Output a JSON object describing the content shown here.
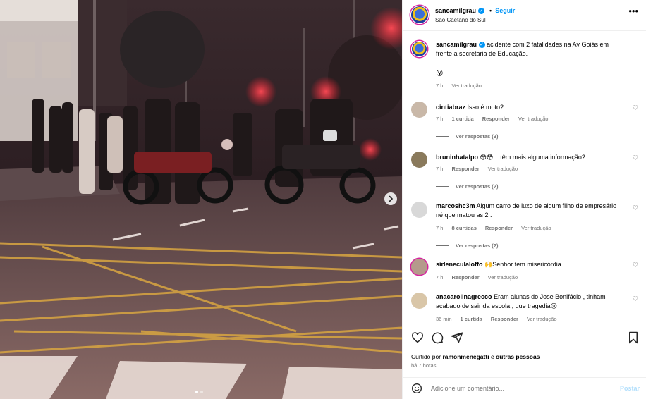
{
  "post": {
    "username": "sancamilgrau",
    "separator": "•",
    "follow_label": "Seguir",
    "location": "São Caetano do Sul",
    "more_icon": "more-horizontal-icon",
    "caption": "acidente com 2 fatalidades na Av Goiás em frente a secretaria de Educação.",
    "caption_emoji": "😮",
    "caption_time": "7 h",
    "caption_translate": "Ver tradução"
  },
  "comments": [
    {
      "user": "cintiabraz",
      "text": "Isso é moto?",
      "time": "7 h",
      "likes": "1 curtida",
      "reply": "Responder",
      "translate": "Ver tradução",
      "replies": "Ver respostas (3)",
      "avatar_color": "#c9b8a8"
    },
    {
      "user": "bruninhatalpo",
      "text": "😳😳... têm mais alguma informação?",
      "time": "7 h",
      "likes": "",
      "reply": "Responder",
      "translate": "Ver tradução",
      "replies": "Ver respostas (2)",
      "avatar_color": "#8a7a5c"
    },
    {
      "user": "marcoshc3m",
      "text": "Algum carro de luxo de algum filho de empresário né que matou as 2 .",
      "time": "7 h",
      "likes": "8 curtidas",
      "reply": "Responder",
      "translate": "Ver tradução",
      "replies": "Ver respostas (2)",
      "avatar_color": "#d8d8d8"
    },
    {
      "user": "sirleneculaloffo",
      "text": "🙌Senhor tem misericórdia",
      "time": "7 h",
      "likes": "",
      "reply": "Responder",
      "translate": "Ver tradução",
      "replies": "",
      "avatar_color": "#b59a8c"
    },
    {
      "user": "anacarolinagrecco",
      "text": "Eram alunas do Jose Bonifácio , tinham acabado de sair da escola , que tragedia😢",
      "time": "36 min",
      "likes": "1 curtida",
      "reply": "Responder",
      "translate": "Ver tradução",
      "replies": "",
      "avatar_color": "#d9c6a8"
    }
  ],
  "actions": {
    "like_icon": "heart-icon",
    "comment_icon": "comment-icon",
    "share_icon": "share-icon",
    "save_icon": "bookmark-icon",
    "liked_by_prefix": "Curtido por",
    "liked_by_user": "ramonmenegatti",
    "liked_by_suffix": "e",
    "liked_by_others": "outras pessoas",
    "timestamp": "há 7 horas"
  },
  "composer": {
    "emoji_icon": "emoji-icon",
    "placeholder": "Adicione um comentário...",
    "post_label": "Postar"
  },
  "carousel": {
    "next_icon": "chevron-right-icon",
    "slides": 2,
    "active_slide": 1
  },
  "colors": {
    "accent": "#0095f6",
    "post_disabled": "#b2dffc",
    "muted": "#737373"
  }
}
